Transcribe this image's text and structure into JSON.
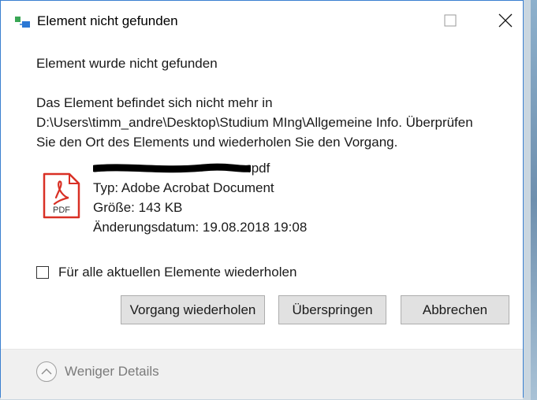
{
  "window": {
    "title": "Element nicht gefunden",
    "icons": {
      "app": "copy-move-icon",
      "maximize": "maximize-icon",
      "close": "close-icon"
    }
  },
  "message": {
    "heading": "Element wurde nicht gefunden",
    "description_lines": [
      "Das Element befindet sich nicht mehr in",
      "D:\\Users\\timm_andre\\Desktop\\Studium MIng\\Allgemeine Info. Überprüfen",
      "Sie den Ort des Elements und wiederholen Sie den Vorgang."
    ]
  },
  "file": {
    "icon": "pdf-file-icon",
    "icon_label": "PDF",
    "name_visible": ".pdf",
    "type": "Typ: Adobe Acrobat Document",
    "size": "Größe: 143 KB",
    "modified": "Änderungsdatum: 19.08.2018 19:08"
  },
  "checkbox": {
    "label": "Für alle aktuellen Elemente wiederholen",
    "checked": false
  },
  "buttons": {
    "retry": "Vorgang wiederholen",
    "skip": "Überspringen",
    "cancel": "Abbrechen"
  },
  "footer": {
    "toggle_label": "Weniger Details",
    "icon": "chevron-up-icon"
  },
  "colors": {
    "pdf_red": "#d93025",
    "window_border": "#3a7fd0",
    "button_bg": "#e1e1e1"
  }
}
